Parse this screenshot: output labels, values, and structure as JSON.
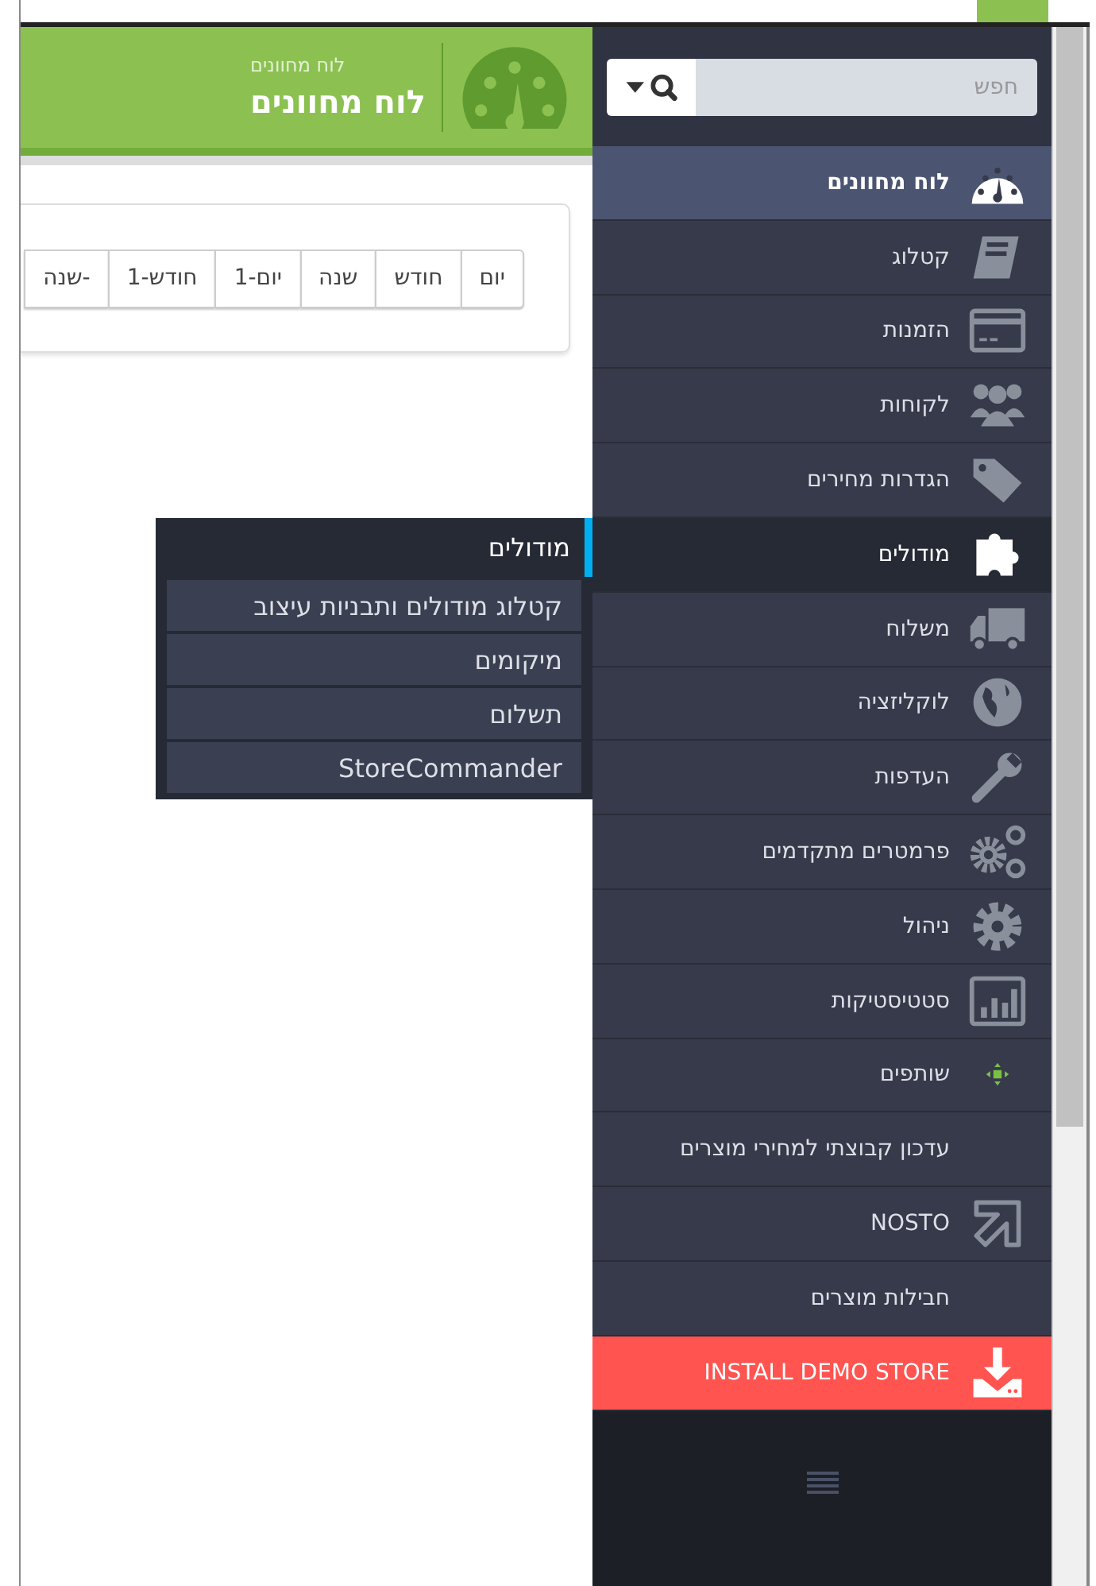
{
  "header": {
    "breadcrumb": "לוח מחוונים",
    "title": "לוח מחוונים"
  },
  "date_ranges": [
    {
      "label": "יום"
    },
    {
      "label": "חודש"
    },
    {
      "label": "שנה"
    },
    {
      "label": "יום-1"
    },
    {
      "label": "חודש-1"
    },
    {
      "label": "שנה-"
    }
  ],
  "search": {
    "placeholder": "חפש"
  },
  "menu": [
    {
      "label": "לוח מחוונים",
      "kind": "link",
      "selected": true,
      "expanded": false
    },
    {
      "label": "קטלוג",
      "kind": "link",
      "selected": false,
      "expanded": false
    },
    {
      "label": "הזמנות",
      "kind": "link",
      "selected": false,
      "expanded": false
    },
    {
      "label": "לקוחות",
      "kind": "link",
      "selected": false,
      "expanded": false
    },
    {
      "label": "הגדרות מחירים",
      "kind": "link",
      "selected": false,
      "expanded": false
    },
    {
      "label": "מודולים",
      "kind": "link",
      "selected": false,
      "expanded": true,
      "submenu": {
        "title": "מודולים",
        "items": [
          "קטלוג מודולים ותבניות עיצוב",
          "מיקומים",
          "תשלום",
          "StoreCommander"
        ]
      }
    },
    {
      "label": "משלוח",
      "kind": "link",
      "selected": false,
      "expanded": false
    },
    {
      "label": "לוקליזציה",
      "kind": "link",
      "selected": false,
      "expanded": false
    },
    {
      "label": "העדפות",
      "kind": "link",
      "selected": false,
      "expanded": false
    },
    {
      "label": "פרמטרים מתקדמים",
      "kind": "link",
      "selected": false,
      "expanded": false
    },
    {
      "label": "ניהול",
      "kind": "link",
      "selected": false,
      "expanded": false
    },
    {
      "label": "סטטיסטיקות",
      "kind": "link",
      "selected": false,
      "expanded": false
    },
    {
      "label": "שותפים",
      "kind": "link",
      "selected": false,
      "expanded": false
    },
    {
      "label": "עדכון קבוצתי למחירי מוצרים",
      "kind": "link",
      "selected": false,
      "expanded": false
    },
    {
      "label": "NOSTO",
      "kind": "link",
      "selected": false,
      "expanded": false
    },
    {
      "label": "חבילות מוצרים",
      "kind": "link",
      "selected": false,
      "expanded": false
    },
    {
      "label": "INSTALL DEMO STORE",
      "kind": "action",
      "selected": false,
      "expanded": false
    }
  ]
}
